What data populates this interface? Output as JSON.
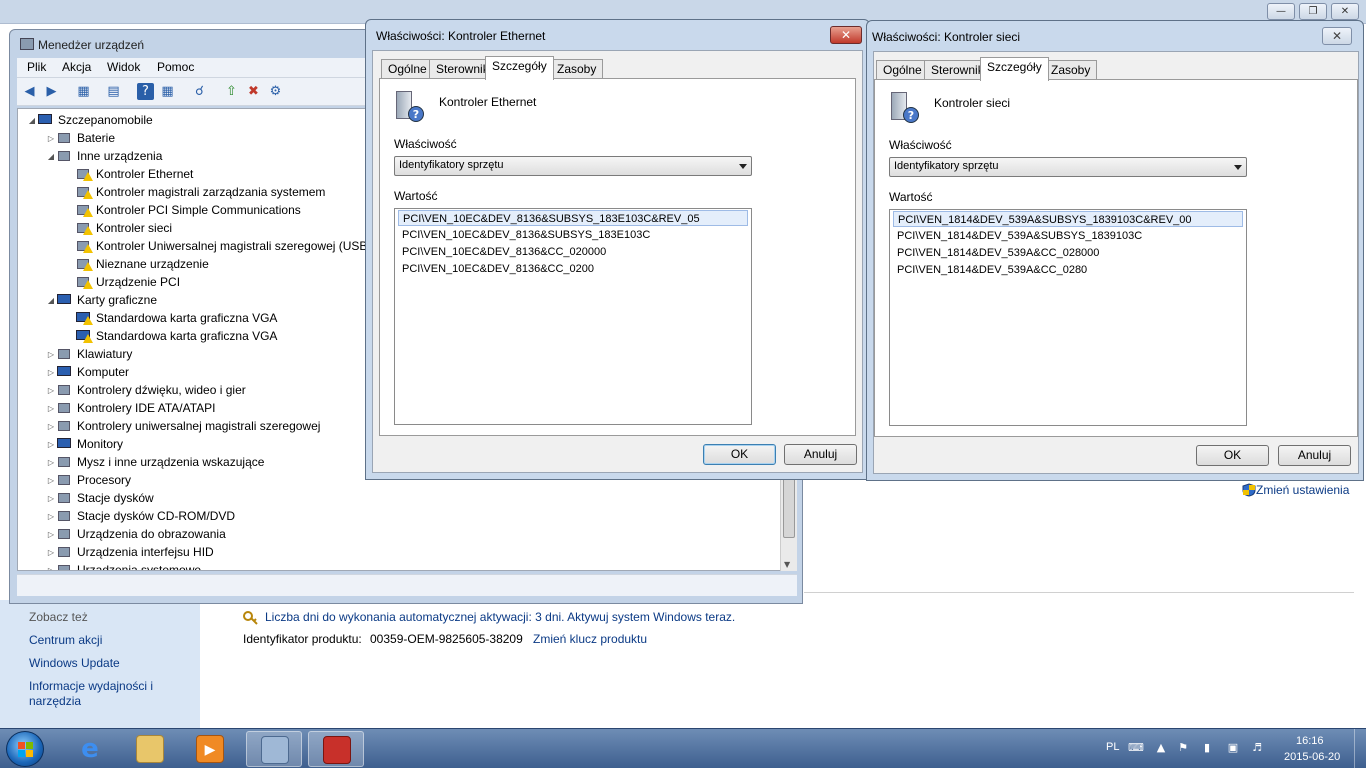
{
  "system_window": {
    "controls": [
      "—",
      "❐",
      "✕"
    ],
    "sidebar_links": [
      "Zobacz też",
      "Centrum akcji",
      "Windows Update",
      "Informacje wydajności i",
      "narzędzia"
    ],
    "activation_text": "Liczba dni do wykonania automatycznej aktywacji: 3 dni. Aktywuj system Windows teraz.",
    "product_id_label": "Identyfikator produktu:",
    "product_id": "00359-OEM-9825605-38209",
    "change_key": "Zmień klucz produktu",
    "change_settings": "Zmień ustawienia"
  },
  "device_manager": {
    "title": "Menedżer urządzeń",
    "menu": [
      "Plik",
      "Akcja",
      "Widok",
      "Pomoc"
    ],
    "tree": [
      {
        "level": 0,
        "exp": "◢",
        "icon": "computer-icon",
        "label": "Szczepanomobile"
      },
      {
        "level": 1,
        "exp": "▷",
        "icon": "battery-icon",
        "label": "Baterie"
      },
      {
        "level": 1,
        "exp": "◢",
        "icon": "unknown-device-icon",
        "label": "Inne urządzenia"
      },
      {
        "level": 2,
        "exp": "",
        "icon": "warning-device-icon",
        "label": "Kontroler Ethernet"
      },
      {
        "level": 2,
        "exp": "",
        "icon": "warning-device-icon",
        "label": "Kontroler magistrali zarządzania systemem"
      },
      {
        "level": 2,
        "exp": "",
        "icon": "warning-device-icon",
        "label": "Kontroler PCI Simple Communications"
      },
      {
        "level": 2,
        "exp": "",
        "icon": "warning-device-icon",
        "label": "Kontroler sieci"
      },
      {
        "level": 2,
        "exp": "",
        "icon": "warning-device-icon",
        "label": "Kontroler Uniwersalnej magistrali szeregowej (USB)"
      },
      {
        "level": 2,
        "exp": "",
        "icon": "warning-device-icon",
        "label": "Nieznane urządzenie"
      },
      {
        "level": 2,
        "exp": "",
        "icon": "warning-device-icon",
        "label": "Urządzenie PCI"
      },
      {
        "level": 1,
        "exp": "◢",
        "icon": "display-adapter-icon",
        "label": "Karty graficzne"
      },
      {
        "level": 2,
        "exp": "",
        "icon": "display-warning-icon",
        "label": "Standardowa karta graficzna VGA"
      },
      {
        "level": 2,
        "exp": "",
        "icon": "display-warning-icon",
        "label": "Standardowa karta graficzna VGA"
      },
      {
        "level": 1,
        "exp": "▷",
        "icon": "keyboard-icon",
        "label": "Klawiatury"
      },
      {
        "level": 1,
        "exp": "▷",
        "icon": "computer-icon",
        "label": "Komputer"
      },
      {
        "level": 1,
        "exp": "▷",
        "icon": "sound-icon",
        "label": "Kontrolery dźwięku, wideo i gier"
      },
      {
        "level": 1,
        "exp": "▷",
        "icon": "ide-icon",
        "label": "Kontrolery IDE ATA/ATAPI"
      },
      {
        "level": 1,
        "exp": "▷",
        "icon": "usb-icon",
        "label": "Kontrolery uniwersalnej magistrali szeregowej"
      },
      {
        "level": 1,
        "exp": "▷",
        "icon": "monitor-icon",
        "label": "Monitory"
      },
      {
        "level": 1,
        "exp": "▷",
        "icon": "mouse-icon",
        "label": "Mysz i inne urządzenia wskazujące"
      },
      {
        "level": 1,
        "exp": "▷",
        "icon": "processor-icon",
        "label": "Procesory"
      },
      {
        "level": 1,
        "exp": "▷",
        "icon": "disk-icon",
        "label": "Stacje dysków"
      },
      {
        "level": 1,
        "exp": "▷",
        "icon": "cdrom-icon",
        "label": "Stacje dysków CD-ROM/DVD"
      },
      {
        "level": 1,
        "exp": "▷",
        "icon": "imaging-icon",
        "label": "Urządzenia do obrazowania"
      },
      {
        "level": 1,
        "exp": "▷",
        "icon": "hid-icon",
        "label": "Urządzenia interfejsu HID"
      },
      {
        "level": 1,
        "exp": "▷",
        "icon": "system-device-icon",
        "label": "Urządzenia systemowe"
      }
    ]
  },
  "dialog_ethernet": {
    "title": "Właściwości: Kontroler Ethernet",
    "tabs": [
      "Ogólne",
      "Sterownik",
      "Szczegóły",
      "Zasoby"
    ],
    "device_name": "Kontroler Ethernet",
    "property_label": "Właściwość",
    "property_value": "Identyfikatory sprzętu",
    "value_label": "Wartość",
    "values": [
      "PCI\\VEN_10EC&DEV_8136&SUBSYS_183E103C&REV_05",
      "PCI\\VEN_10EC&DEV_8136&SUBSYS_183E103C",
      "PCI\\VEN_10EC&DEV_8136&CC_020000",
      "PCI\\VEN_10EC&DEV_8136&CC_0200"
    ],
    "ok": "OK",
    "cancel": "Anuluj"
  },
  "dialog_network": {
    "title": "Właściwości: Kontroler sieci",
    "tabs": [
      "Ogólne",
      "Sterownik",
      "Szczegóły",
      "Zasoby"
    ],
    "device_name": "Kontroler sieci",
    "property_label": "Właściwość",
    "property_value": "Identyfikatory sprzętu",
    "value_label": "Wartość",
    "values": [
      "PCI\\VEN_1814&DEV_539A&SUBSYS_1839103C&REV_00",
      "PCI\\VEN_1814&DEV_539A&SUBSYS_1839103C",
      "PCI\\VEN_1814&DEV_539A&CC_028000",
      "PCI\\VEN_1814&DEV_539A&CC_0280"
    ],
    "ok": "OK",
    "cancel": "Anuluj"
  },
  "taskbar": {
    "language": "PL",
    "time": "16:16",
    "date": "2015-06-20",
    "apps": [
      "internet-explorer-icon",
      "explorer-icon",
      "media-player-icon",
      "device-manager-icon",
      "toolbox-icon"
    ]
  }
}
